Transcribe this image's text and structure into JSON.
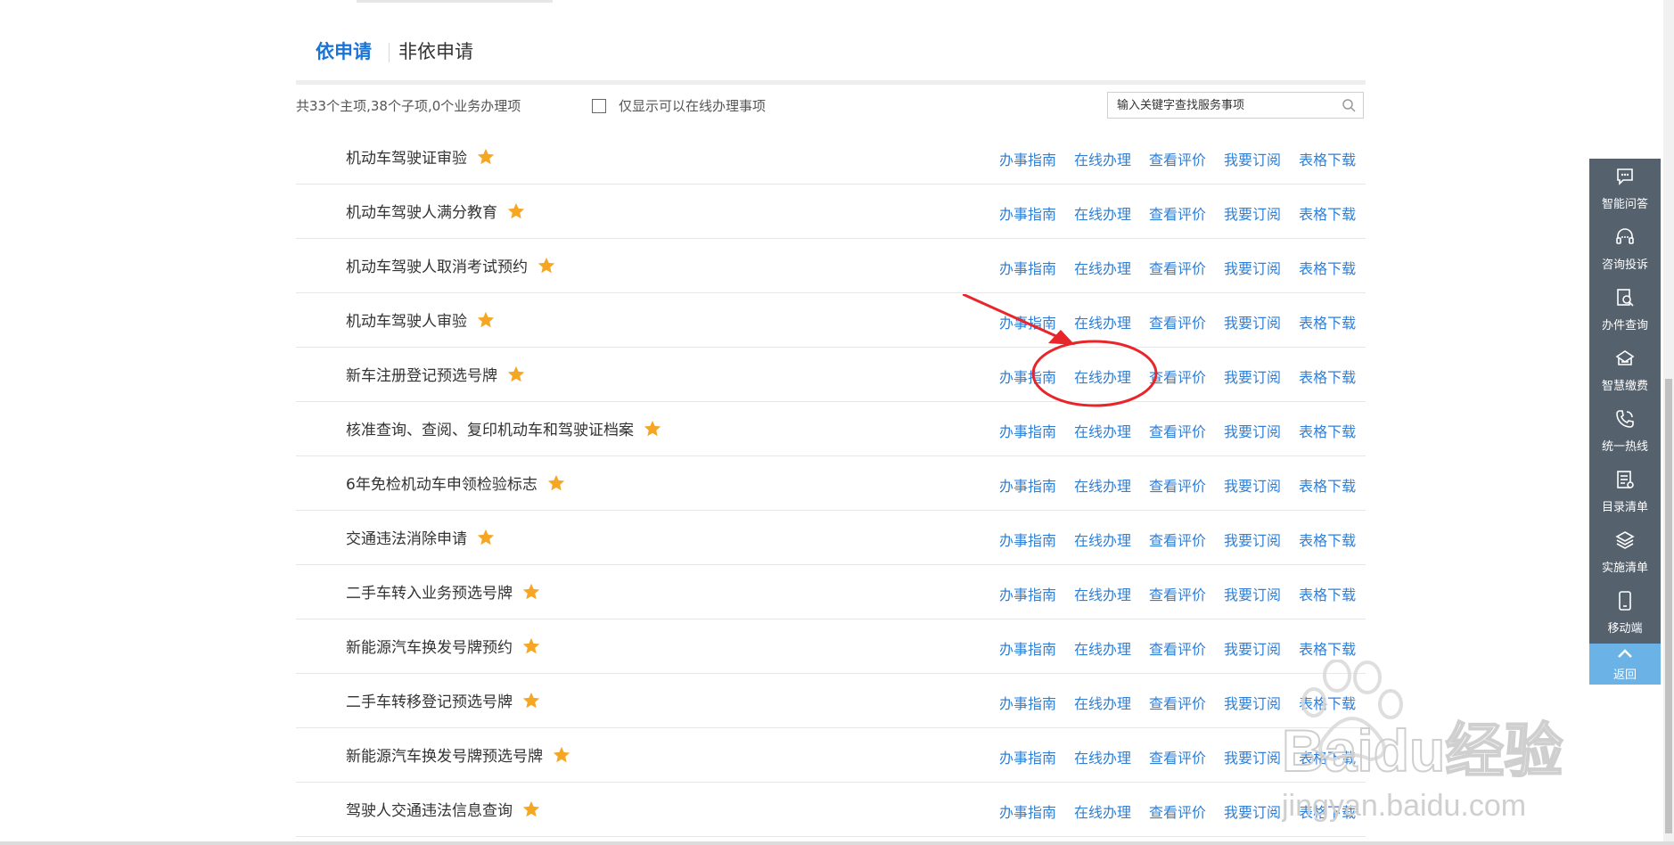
{
  "tabs": {
    "active": "依申请",
    "other": "非依申请"
  },
  "summary": "共33个主项,38个子项,0个业务办理项",
  "filter_label": "仅显示可以在线办理事项",
  "search": {
    "placeholder": "输入关键字查找服务事项"
  },
  "actions": [
    "办事指南",
    "在线办理",
    "查看评价",
    "我要订阅",
    "表格下载"
  ],
  "items": [
    {
      "name": "机动车驾驶证审验"
    },
    {
      "name": "机动车驾驶人满分教育"
    },
    {
      "name": "机动车驾驶人取消考试预约"
    },
    {
      "name": "机动车驾驶人审验"
    },
    {
      "name": "新车注册登记预选号牌"
    },
    {
      "name": "核准查询、查阅、复印机动车和驾驶证档案"
    },
    {
      "name": "6年免检机动车申领检验标志"
    },
    {
      "name": "交通违法消除申请"
    },
    {
      "name": "二手车转入业务预选号牌"
    },
    {
      "name": "新能源汽车换发号牌预约"
    },
    {
      "name": "二手车转移登记预选号牌"
    },
    {
      "name": "新能源汽车换发号牌预选号牌"
    },
    {
      "name": "驾驶人交通违法信息查询"
    }
  ],
  "sidebar": {
    "items": [
      {
        "label": "智能问答",
        "icon": "chat-bubble-icon"
      },
      {
        "label": "咨询投诉",
        "icon": "headset-icon"
      },
      {
        "label": "办件查询",
        "icon": "document-search-icon"
      },
      {
        "label": "智慧缴费",
        "icon": "payment-icon"
      },
      {
        "label": "统一热线",
        "icon": "phone-icon"
      },
      {
        "label": "目录清单",
        "icon": "catalog-icon"
      },
      {
        "label": "实施清单",
        "icon": "layers-icon"
      },
      {
        "label": "移动端",
        "icon": "mobile-icon"
      }
    ],
    "back_label": "返回"
  },
  "watermark": {
    "brand": "Baidu经验",
    "url": "jingyan.baidu.com"
  },
  "colors": {
    "link": "#2f7fd6",
    "active_tab": "#1a73d6",
    "star": "#f5a623",
    "sidebar": "#55616d",
    "back": "#6bb3e6",
    "annotation": "#e8252a"
  }
}
